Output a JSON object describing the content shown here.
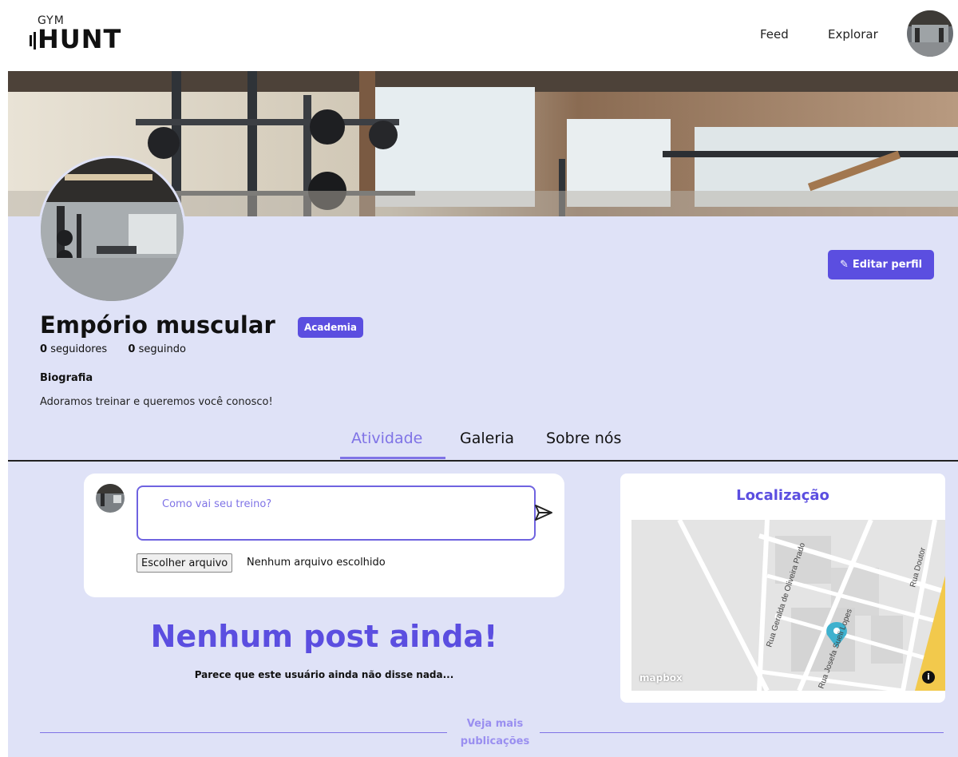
{
  "header": {
    "logo_small": "GYM",
    "logo_big": "HUNT",
    "nav": {
      "feed": "Feed",
      "explore": "Explorar"
    }
  },
  "profile": {
    "edit_button": "Editar perfil",
    "name": "Empório muscular",
    "badge": "Academia",
    "followers_count": "0",
    "followers_label": "seguidores",
    "following_count": "0",
    "following_label": "seguindo",
    "bio_title": "Biografia",
    "bio_text": "Adoramos treinar e queremos você conosco!"
  },
  "tabs": [
    {
      "label": "Atividade",
      "active": true
    },
    {
      "label": "Galeria",
      "active": false
    },
    {
      "label": "Sobre nós",
      "active": false
    }
  ],
  "composer": {
    "placeholder": "Como vai seu treino?",
    "file_button": "Escolher arquivo",
    "file_status": "Nenhum arquivo escolhido"
  },
  "empty_state": {
    "title": "Nenhum post ainda!",
    "subtitle": "Parece que este usuário ainda não disse nada..."
  },
  "more_link": "Veja mais publicações",
  "location": {
    "title": "Localização",
    "streets": [
      "Rua Geralda de Oliveira Prado",
      "Rua Doutor",
      "Rua Josefa Sueli Lopes"
    ],
    "attribution": "mapbox"
  },
  "colors": {
    "accent": "#5b4ee0",
    "accent_light": "#7f73e6",
    "profile_bg": "#dfe2f7",
    "card_bg": "#ffffff"
  },
  "icons": [
    "dumbbell-logo-icon",
    "pencil-icon",
    "send-icon",
    "map-pin-icon",
    "info-icon"
  ]
}
